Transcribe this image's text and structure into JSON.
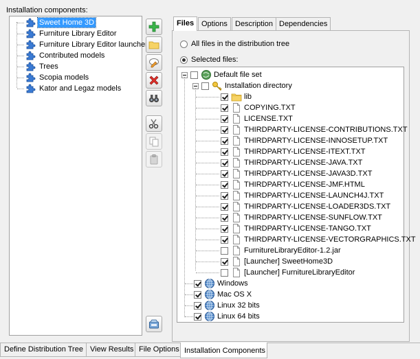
{
  "components": {
    "label": "Installation components:",
    "items": [
      {
        "label": "Sweet Home 3D",
        "selected": true
      },
      {
        "label": "Furniture Library Editor"
      },
      {
        "label": "Furniture Library Editor launcher"
      },
      {
        "label": "Contributed models"
      },
      {
        "label": "Trees"
      },
      {
        "label": "Scopia models"
      },
      {
        "label": "Kator and Legaz models"
      }
    ]
  },
  "toolbar": [
    {
      "name": "add-button",
      "icon": "plus-icon"
    },
    {
      "name": "open-button",
      "icon": "folder-icon"
    },
    {
      "name": "edit-button",
      "icon": "edit-icon"
    },
    {
      "name": "delete-button",
      "icon": "delete-icon"
    },
    {
      "name": "find-button",
      "icon": "binoculars-icon"
    },
    {
      "name": "cut-button",
      "icon": "scissors-icon"
    },
    {
      "name": "copy-button",
      "icon": "copy-icon",
      "disabled": true
    },
    {
      "name": "paste-button",
      "icon": "paste-icon",
      "disabled": true
    },
    {
      "name": "build-button",
      "icon": "build-icon"
    }
  ],
  "tabs": [
    {
      "label": "Files",
      "active": true
    },
    {
      "label": "Options"
    },
    {
      "label": "Description"
    },
    {
      "label": "Dependencies"
    }
  ],
  "files": {
    "option_all": "All files in the distribution tree",
    "option_selected": "Selected files:",
    "selected_option": "selected",
    "tree": {
      "root": {
        "label": "Default file set",
        "checked": false
      },
      "install_dir": {
        "label": "Installation directory",
        "checked": false
      },
      "entries": [
        {
          "label": "lib",
          "type": "folder",
          "checked": true
        },
        {
          "label": "COPYING.TXT",
          "type": "file",
          "checked": true
        },
        {
          "label": "LICENSE.TXT",
          "type": "file",
          "checked": true
        },
        {
          "label": "THIRDPARTY-LICENSE-CONTRIBUTIONS.TXT",
          "type": "file",
          "checked": true
        },
        {
          "label": "THIRDPARTY-LICENSE-INNOSETUP.TXT",
          "type": "file",
          "checked": true
        },
        {
          "label": "THIRDPARTY-LICENSE-ITEXT.TXT",
          "type": "file",
          "checked": true
        },
        {
          "label": "THIRDPARTY-LICENSE-JAVA.TXT",
          "type": "file",
          "checked": true
        },
        {
          "label": "THIRDPARTY-LICENSE-JAVA3D.TXT",
          "type": "file",
          "checked": true
        },
        {
          "label": "THIRDPARTY-LICENSE-JMF.HTML",
          "type": "file",
          "checked": true
        },
        {
          "label": "THIRDPARTY-LICENSE-LAUNCH4J.TXT",
          "type": "file",
          "checked": true
        },
        {
          "label": "THIRDPARTY-LICENSE-LOADER3DS.TXT",
          "type": "file",
          "checked": true
        },
        {
          "label": "THIRDPARTY-LICENSE-SUNFLOW.TXT",
          "type": "file",
          "checked": true
        },
        {
          "label": "THIRDPARTY-LICENSE-TANGO.TXT",
          "type": "file",
          "checked": true
        },
        {
          "label": "THIRDPARTY-LICENSE-VECTORGRAPHICS.TXT",
          "type": "file",
          "checked": true
        },
        {
          "label": "FurnitureLibraryEditor-1.2.jar",
          "type": "file",
          "checked": false
        },
        {
          "label": "[Launcher] SweetHome3D",
          "type": "file",
          "checked": true
        },
        {
          "label": "[Launcher] FurnitureLibraryEditor",
          "type": "file",
          "checked": false
        }
      ],
      "platforms": [
        {
          "label": "Windows",
          "checked": true
        },
        {
          "label": "Mac OS X",
          "checked": true
        },
        {
          "label": "Linux 32 bits",
          "checked": true
        },
        {
          "label": "Linux 64 bits",
          "checked": true
        }
      ]
    }
  },
  "bottom_tabs": [
    {
      "label": "Define Distribution Tree"
    },
    {
      "label": "View Results"
    },
    {
      "label": "File Options"
    },
    {
      "label": "Installation Components",
      "active": true
    }
  ],
  "colors": {
    "selection": "#3399ff",
    "panel": "#f0f0f0"
  }
}
